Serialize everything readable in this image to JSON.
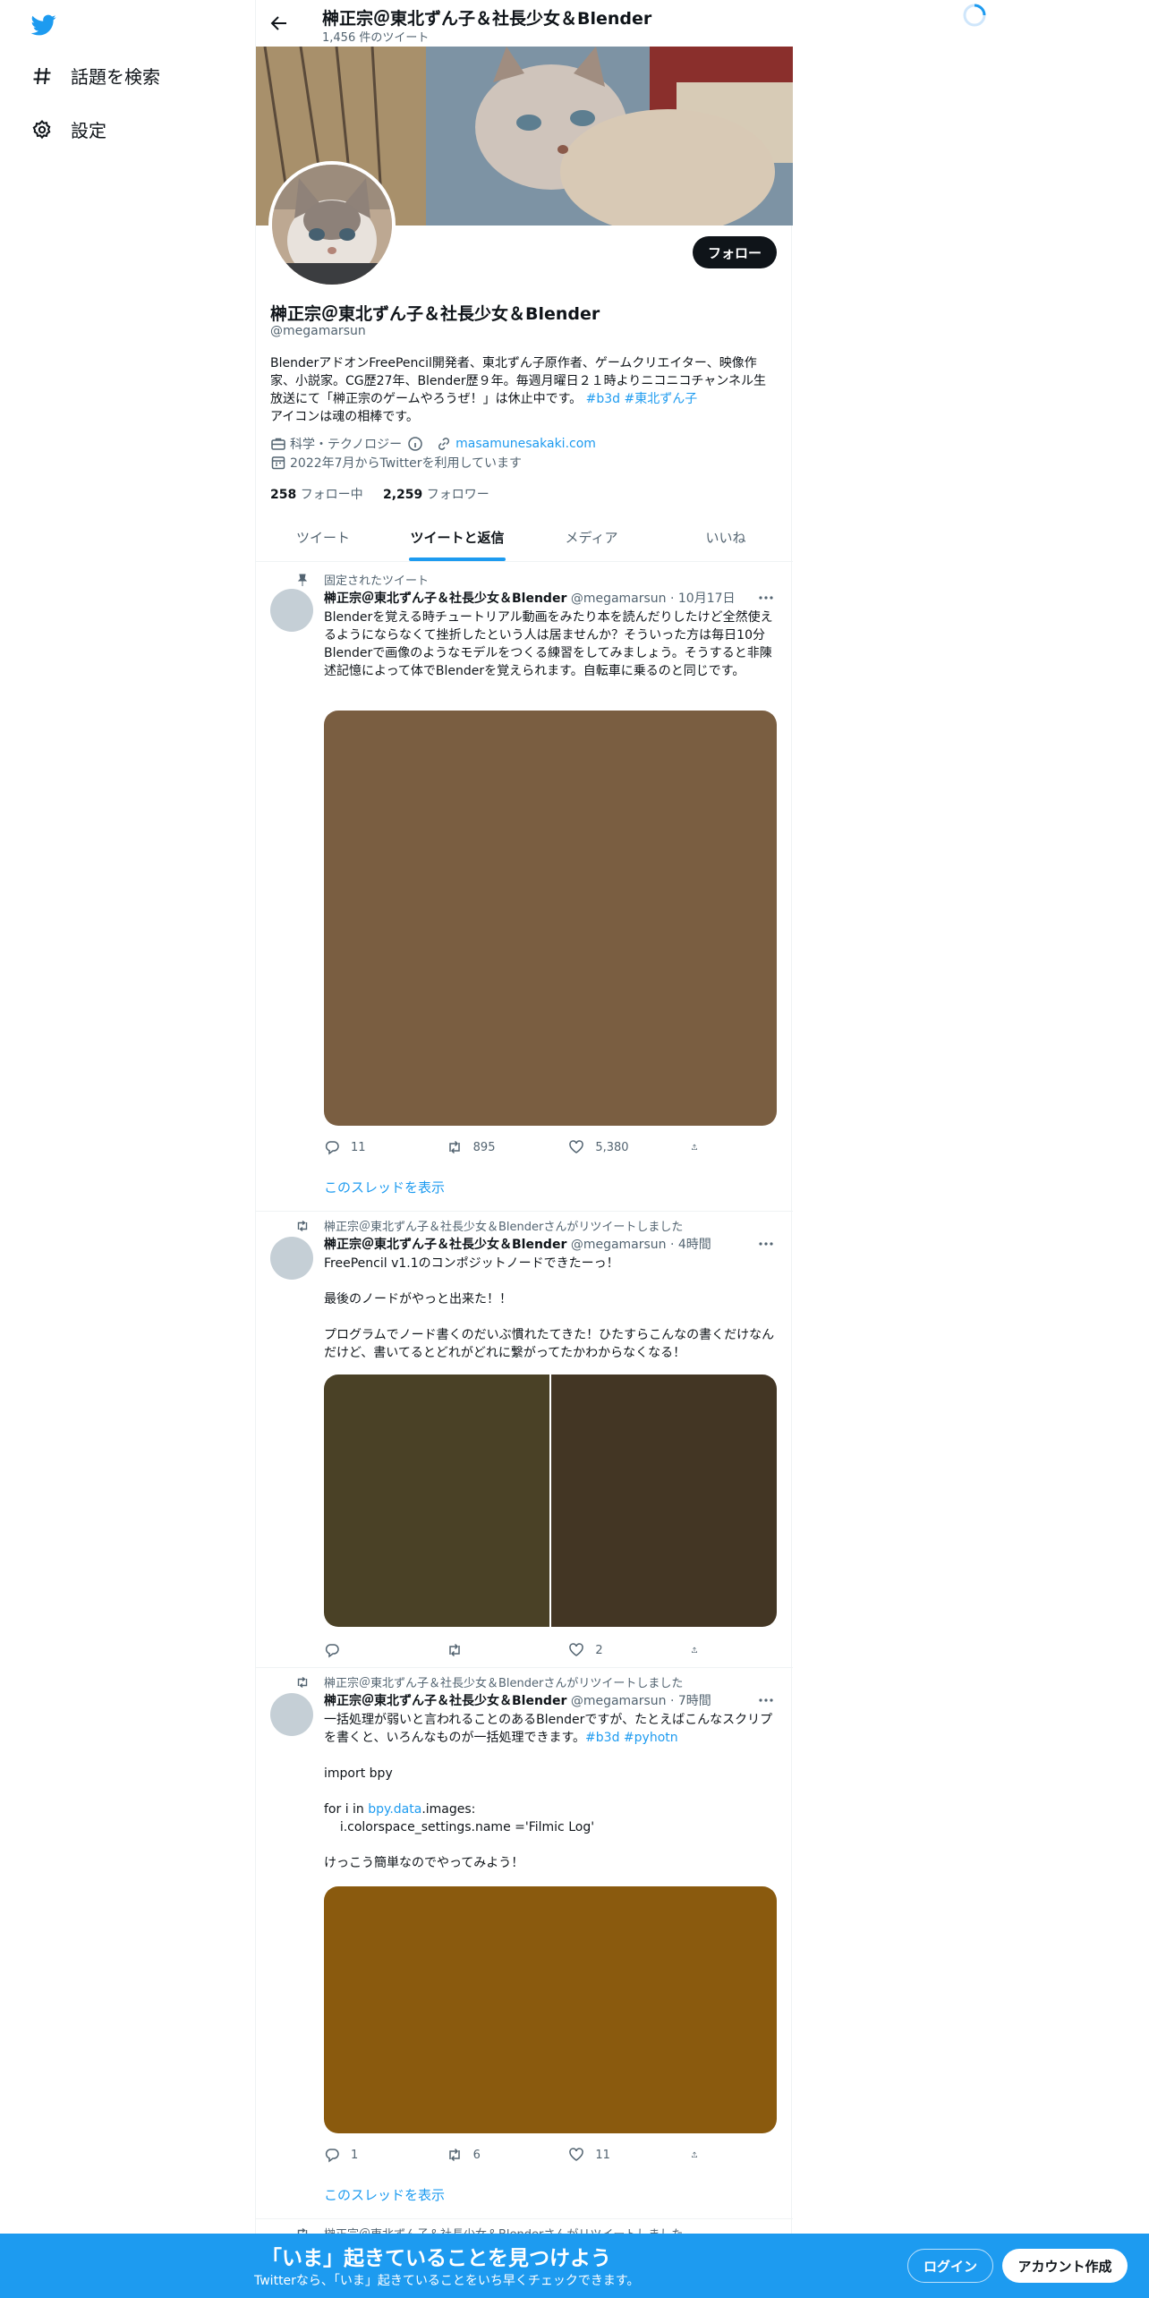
{
  "nav": {
    "items": [
      {
        "label": "話題を検索",
        "icon": "hashtag-icon"
      },
      {
        "label": "設定",
        "icon": "gear-icon"
      }
    ]
  },
  "header": {
    "title": "榊正宗＠東北ずん子＆社長少女＆Blender",
    "tweet_count": "1,456 件のツイート"
  },
  "profile": {
    "follow_label": "フォロー",
    "name": "榊正宗＠東北ずん子＆社長少女＆Blender",
    "handle": "@megamarsun",
    "bio_text": "BlenderアドオンFreePencil開発者、東北ずん子原作者、ゲームクリエイター、映像作家、小説家。CG歴27年、Blender歴９年。毎週月曜日２１時よりニコニコチャンネル生放送にて「榊正宗のゲームやろうぜ！」は休止中です。 ",
    "bio_tag1": "#b3d",
    "bio_tag2": "#東北ずん子",
    "bio_tail": "アイコンは魂の相棒です。",
    "category": "科学・テクノロジー",
    "url": "masamunesakaki.com",
    "joined": "2022年7月からTwitterを利用しています",
    "following_count": "258",
    "following_label": "フォロー中",
    "followers_count": "2,259",
    "followers_label": "フォロワー"
  },
  "tabs": [
    {
      "label": "ツイート",
      "active": false
    },
    {
      "label": "ツイートと返信",
      "active": true
    },
    {
      "label": "メディア",
      "active": false
    },
    {
      "label": "いいね",
      "active": false
    }
  ],
  "tweets": [
    {
      "context": "固定されたツイート",
      "name": "榊正宗＠東北ずん子＆社長少女＆Blender",
      "handle": "@megamarsun",
      "time": "· 10月17日",
      "text": "Blenderを覚える時チュートリアル動画をみたり本を読んだりしたけど全然使えるようにならなくて挫折したという人は居ませんか？そういった方は毎日10分Blenderで画像のようなモデルをつくる練習をしてみましょう。そうすると非陳述記憶によって体でBlenderを覚えられます。自転車に乗るのと同じです。",
      "replies": "11",
      "retweets": "895",
      "likes": "5,380",
      "show_thread": "このスレッドを表示"
    },
    {
      "context": "榊正宗＠東北ずん子＆社長少女＆Blenderさんがリツイートしました",
      "name": "榊正宗＠東北ずん子＆社長少女＆Blender",
      "handle": "@megamarsun",
      "time": "· 4時間",
      "text": "FreePencil v1.1のコンポジットノードできたーっ！\n\n最後のノードがやっと出来た！！\n\nプログラムでノード書くのだいぶ慣れたてきた！ひたすらこんなの書くだけなんだけど、書いてるとどれがどれに繋がってたかわからなくなる！",
      "replies": "",
      "retweets": "",
      "likes": "2"
    },
    {
      "context": "榊正宗＠東北ずん子＆社長少女＆Blenderさんがリツイートしました",
      "name": "榊正宗＠東北ずん子＆社長少女＆Blender",
      "handle": "@megamarsun",
      "time": "· 7時間",
      "text_a": "一括処理が弱いと言われることのあるBlenderですが、たとえばこんなスクリプを書くと、いろんなものが一括処理できます。",
      "tag1": "#b3d",
      "tag2": "#pyhotn",
      "line_import": "import bpy",
      "line_for_pre": "for i in ",
      "line_for_link": "bpy.data",
      "line_for_post": ".images:",
      "line_body": "    i.colorspace_settings.name ='Filmic Log'",
      "line_end": "けっこう簡単なのでやってみよう！",
      "replies": "1",
      "retweets": "6",
      "likes": "11",
      "show_thread": "このスレッドを表示"
    },
    {
      "context": "榊正宗＠東北ずん子＆社長少女＆Blenderさんがリツイートしました"
    }
  ],
  "bottom_bar": {
    "title": "「いま」起きていることを見つけよう",
    "subtitle": "Twitterなら、「いま」起きていることをいち早くチェックできます。",
    "login_label": "ログイン",
    "signup_label": "アカウント作成"
  },
  "colors": {
    "accent": "#1d9bf0",
    "text": "#0f1419",
    "muted": "#536471",
    "media1": "#7a5e41",
    "media2_left": "#4a4126",
    "media2_right": "#433624",
    "media3": "#8a5a0e"
  }
}
